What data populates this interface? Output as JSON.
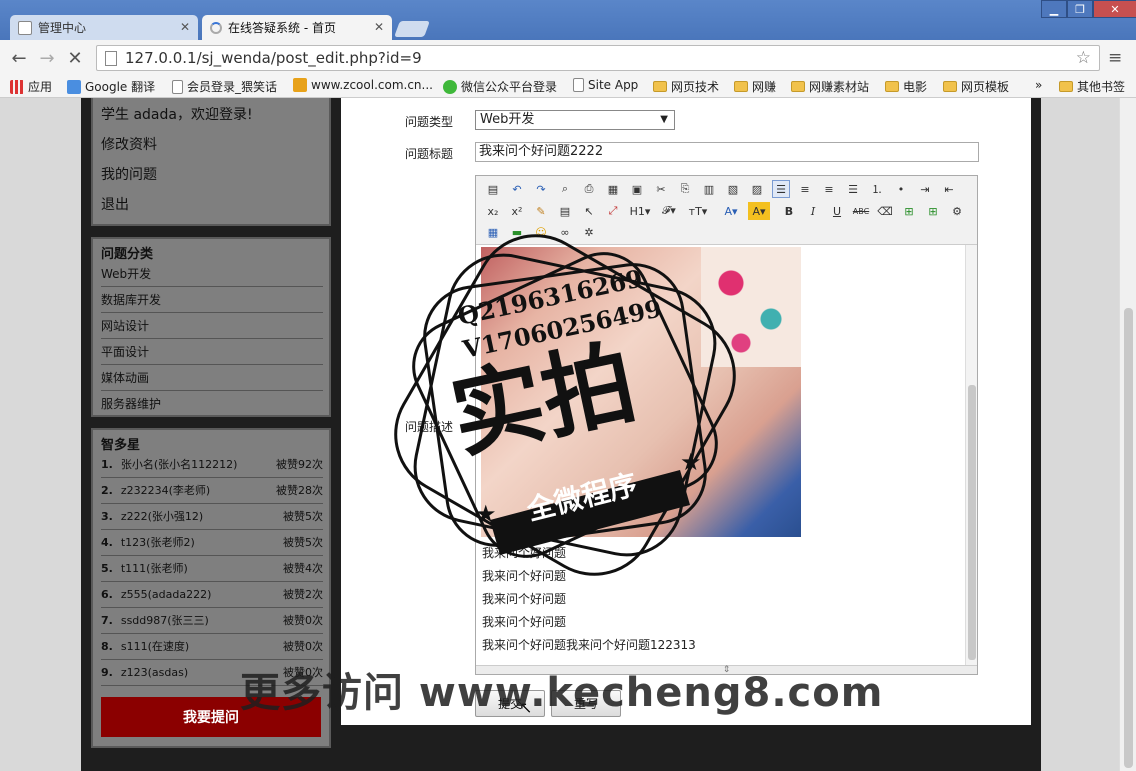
{
  "browser": {
    "tabs": [
      {
        "label": "管理中心",
        "active": false
      },
      {
        "label": "在线答疑系统 - 首页",
        "active": true
      }
    ],
    "url": "127.0.0.1/sj_wenda/post_edit.php?id=9",
    "bookmarks": [
      {
        "label": "应用",
        "icon": "apps-icon"
      },
      {
        "label": "Google 翻译",
        "icon": "translate-icon"
      },
      {
        "label": "会员登录_猥笑话",
        "icon": "page-icon"
      },
      {
        "label": "www.zcool.com.cn...",
        "icon": "zcool-icon"
      },
      {
        "label": "微信公众平台登录",
        "icon": "wechat-icon"
      },
      {
        "label": "Site App",
        "icon": "page-icon"
      },
      {
        "label": "网页技术",
        "icon": "folder-icon"
      },
      {
        "label": "网赚",
        "icon": "folder-icon"
      },
      {
        "label": "网赚素材站",
        "icon": "folder-icon"
      },
      {
        "label": "电影",
        "icon": "folder-icon"
      },
      {
        "label": "网页模板",
        "icon": "folder-icon"
      },
      {
        "label": "»",
        "icon": ""
      },
      {
        "label": "其他书签",
        "icon": "folder-icon"
      }
    ]
  },
  "sidebar": {
    "user": {
      "greeting": "学生 adada，欢迎登录!",
      "links": [
        "修改资料",
        "我的问题",
        "退出"
      ]
    },
    "categories": {
      "title": "问题分类",
      "items": [
        "Web开发",
        "数据库开发",
        "网站设计",
        "平面设计",
        "媒体动画",
        "服务器维护"
      ]
    },
    "ranking": {
      "title": "智多星",
      "rows": [
        {
          "rank": "1.",
          "name": "张小名(张小名112212)",
          "likes": "被赞92次"
        },
        {
          "rank": "2.",
          "name": "z232234(李老师)",
          "likes": "被赞28次"
        },
        {
          "rank": "3.",
          "name": "z222(张小强12)",
          "likes": "被赞5次"
        },
        {
          "rank": "4.",
          "name": "t123(张老师2)",
          "likes": "被赞5次"
        },
        {
          "rank": "5.",
          "name": "t111(张老师)",
          "likes": "被赞4次"
        },
        {
          "rank": "6.",
          "name": "z555(adada222)",
          "likes": "被赞2次"
        },
        {
          "rank": "7.",
          "name": "ssdd987(张三三)",
          "likes": "被赞0次"
        },
        {
          "rank": "8.",
          "name": "s111(在速度)",
          "likes": "被赞0次"
        },
        {
          "rank": "9.",
          "name": "z123(asdas)",
          "likes": "被赞0次"
        }
      ]
    },
    "ask_button": "我要提问"
  },
  "form": {
    "type_label": "问题类型",
    "type_value": "Web开发",
    "title_label": "问题标题",
    "title_value": "我来问个好问题2222",
    "desc_label": "问题描述",
    "editor_lines": [
      "我来问个好问题",
      "我来问个好问题",
      "我来问个好问题",
      "我来问个好问题",
      "我来问个好问题我来问个好问题122313"
    ],
    "submit_label": "提交",
    "reset_label": "重写"
  },
  "overlay": {
    "stamp_contact_q": "Q2196316269",
    "stamp_contact_v": "V17060256499",
    "stamp_big": "实拍",
    "stamp_banner": "全微程序",
    "site_watermark": "更多访问 www.kecheng8.com"
  }
}
